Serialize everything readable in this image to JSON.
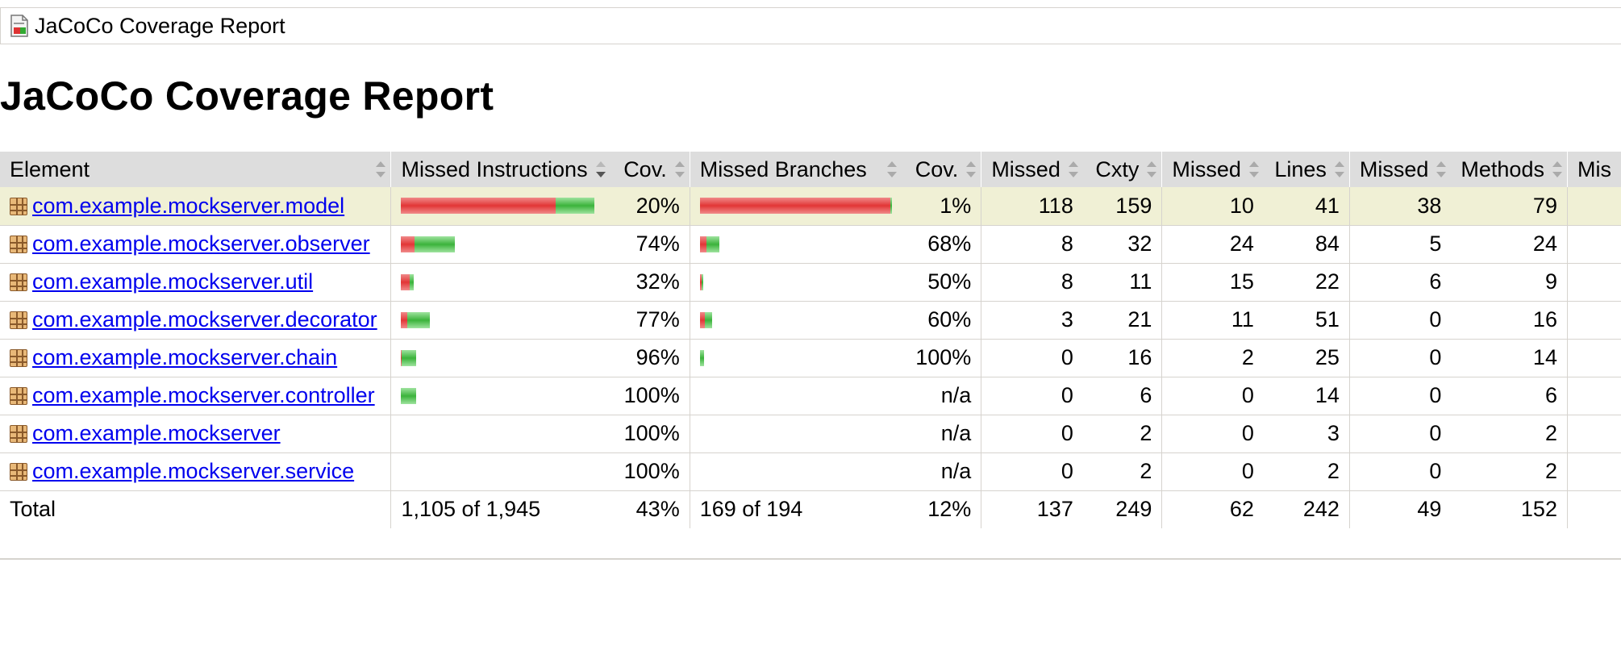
{
  "breadcrumb": {
    "title": "JaCoCo Coverage Report"
  },
  "page_title": "JaCoCo Coverage Report",
  "table": {
    "headers": {
      "element": "Element",
      "missed_instructions": "Missed Instructions",
      "instr_cov": "Cov.",
      "missed_branches": "Missed Branches",
      "branch_cov": "Cov.",
      "missed_cxty": "Missed",
      "cxty": "Cxty",
      "missed_lines": "Missed",
      "lines": "Lines",
      "missed_methods": "Missed",
      "methods": "Methods",
      "missed_classes_truncated": "Mis"
    },
    "rows": [
      {
        "name": "com.example.mockserver.model",
        "instr_missed_frac": 0.8,
        "instr_cov": "20%",
        "branch_missed_frac": 0.99,
        "branch_cov": "1%",
        "missed_cxty": "118",
        "cxty": "159",
        "missed_lines": "10",
        "lines": "41",
        "missed_methods": "38",
        "methods": "79"
      },
      {
        "name": "com.example.mockserver.observer",
        "instr_missed_frac": 0.26,
        "instr_cov": "74%",
        "branch_missed_frac": 0.32,
        "branch_cov": "68%",
        "missed_cxty": "8",
        "cxty": "32",
        "missed_lines": "24",
        "lines": "84",
        "missed_methods": "5",
        "methods": "24"
      },
      {
        "name": "com.example.mockserver.util",
        "instr_missed_frac": 0.68,
        "instr_cov": "32%",
        "branch_missed_frac": 0.5,
        "branch_cov": "50%",
        "missed_cxty": "8",
        "cxty": "11",
        "missed_lines": "15",
        "lines": "22",
        "missed_methods": "6",
        "methods": "9"
      },
      {
        "name": "com.example.mockserver.decorator",
        "instr_missed_frac": 0.23,
        "instr_cov": "77%",
        "branch_missed_frac": 0.4,
        "branch_cov": "60%",
        "missed_cxty": "3",
        "cxty": "21",
        "missed_lines": "11",
        "lines": "51",
        "missed_methods": "0",
        "methods": "16"
      },
      {
        "name": "com.example.mockserver.chain",
        "instr_missed_frac": 0.04,
        "instr_cov": "96%",
        "branch_missed_frac": 0.0,
        "branch_cov": "100%",
        "missed_cxty": "0",
        "cxty": "16",
        "missed_lines": "2",
        "lines": "25",
        "missed_methods": "0",
        "methods": "14"
      },
      {
        "name": "com.example.mockserver.controller",
        "instr_missed_frac": 0.0,
        "instr_cov": "100%",
        "branch_missed_frac": null,
        "branch_cov": "n/a",
        "missed_cxty": "0",
        "cxty": "6",
        "missed_lines": "0",
        "lines": "14",
        "missed_methods": "0",
        "methods": "6"
      },
      {
        "name": "com.example.mockserver",
        "instr_missed_frac": null,
        "instr_cov": "100%",
        "branch_missed_frac": null,
        "branch_cov": "n/a",
        "missed_cxty": "0",
        "cxty": "2",
        "missed_lines": "0",
        "lines": "3",
        "missed_methods": "0",
        "methods": "2"
      },
      {
        "name": "com.example.mockserver.service",
        "instr_missed_frac": null,
        "instr_cov": "100%",
        "branch_missed_frac": null,
        "branch_cov": "n/a",
        "missed_cxty": "0",
        "cxty": "2",
        "missed_lines": "0",
        "lines": "2",
        "missed_methods": "0",
        "methods": "2"
      }
    ],
    "total": {
      "label": "Total",
      "instructions": "1,105 of 1,945",
      "instr_cov": "43%",
      "branches": "169 of 194",
      "branch_cov": "12%",
      "missed_cxty": "137",
      "cxty": "249",
      "missed_lines": "62",
      "lines": "242",
      "missed_methods": "49",
      "methods": "152"
    }
  },
  "colors": {
    "missed_bar": "#e23636",
    "covered_bar": "#3bb33b",
    "header_bg": "#dddddd",
    "highlight_row_bg": "#f0f0d5",
    "link": "#0000ee"
  }
}
